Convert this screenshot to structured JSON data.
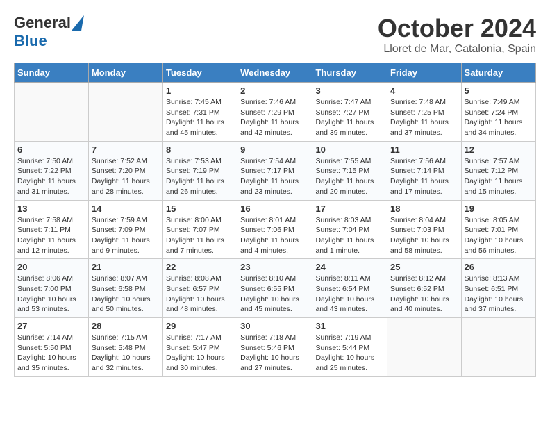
{
  "header": {
    "logo_general": "General",
    "logo_blue": "Blue",
    "month_title": "October 2024",
    "location": "Lloret de Mar, Catalonia, Spain"
  },
  "days_of_week": [
    "Sunday",
    "Monday",
    "Tuesday",
    "Wednesday",
    "Thursday",
    "Friday",
    "Saturday"
  ],
  "weeks": [
    [
      {
        "day": "",
        "info": ""
      },
      {
        "day": "",
        "info": ""
      },
      {
        "day": "1",
        "info": "Sunrise: 7:45 AM\nSunset: 7:31 PM\nDaylight: 11 hours and 45 minutes."
      },
      {
        "day": "2",
        "info": "Sunrise: 7:46 AM\nSunset: 7:29 PM\nDaylight: 11 hours and 42 minutes."
      },
      {
        "day": "3",
        "info": "Sunrise: 7:47 AM\nSunset: 7:27 PM\nDaylight: 11 hours and 39 minutes."
      },
      {
        "day": "4",
        "info": "Sunrise: 7:48 AM\nSunset: 7:25 PM\nDaylight: 11 hours and 37 minutes."
      },
      {
        "day": "5",
        "info": "Sunrise: 7:49 AM\nSunset: 7:24 PM\nDaylight: 11 hours and 34 minutes."
      }
    ],
    [
      {
        "day": "6",
        "info": "Sunrise: 7:50 AM\nSunset: 7:22 PM\nDaylight: 11 hours and 31 minutes."
      },
      {
        "day": "7",
        "info": "Sunrise: 7:52 AM\nSunset: 7:20 PM\nDaylight: 11 hours and 28 minutes."
      },
      {
        "day": "8",
        "info": "Sunrise: 7:53 AM\nSunset: 7:19 PM\nDaylight: 11 hours and 26 minutes."
      },
      {
        "day": "9",
        "info": "Sunrise: 7:54 AM\nSunset: 7:17 PM\nDaylight: 11 hours and 23 minutes."
      },
      {
        "day": "10",
        "info": "Sunrise: 7:55 AM\nSunset: 7:15 PM\nDaylight: 11 hours and 20 minutes."
      },
      {
        "day": "11",
        "info": "Sunrise: 7:56 AM\nSunset: 7:14 PM\nDaylight: 11 hours and 17 minutes."
      },
      {
        "day": "12",
        "info": "Sunrise: 7:57 AM\nSunset: 7:12 PM\nDaylight: 11 hours and 15 minutes."
      }
    ],
    [
      {
        "day": "13",
        "info": "Sunrise: 7:58 AM\nSunset: 7:11 PM\nDaylight: 11 hours and 12 minutes."
      },
      {
        "day": "14",
        "info": "Sunrise: 7:59 AM\nSunset: 7:09 PM\nDaylight: 11 hours and 9 minutes."
      },
      {
        "day": "15",
        "info": "Sunrise: 8:00 AM\nSunset: 7:07 PM\nDaylight: 11 hours and 7 minutes."
      },
      {
        "day": "16",
        "info": "Sunrise: 8:01 AM\nSunset: 7:06 PM\nDaylight: 11 hours and 4 minutes."
      },
      {
        "day": "17",
        "info": "Sunrise: 8:03 AM\nSunset: 7:04 PM\nDaylight: 11 hours and 1 minute."
      },
      {
        "day": "18",
        "info": "Sunrise: 8:04 AM\nSunset: 7:03 PM\nDaylight: 10 hours and 58 minutes."
      },
      {
        "day": "19",
        "info": "Sunrise: 8:05 AM\nSunset: 7:01 PM\nDaylight: 10 hours and 56 minutes."
      }
    ],
    [
      {
        "day": "20",
        "info": "Sunrise: 8:06 AM\nSunset: 7:00 PM\nDaylight: 10 hours and 53 minutes."
      },
      {
        "day": "21",
        "info": "Sunrise: 8:07 AM\nSunset: 6:58 PM\nDaylight: 10 hours and 50 minutes."
      },
      {
        "day": "22",
        "info": "Sunrise: 8:08 AM\nSunset: 6:57 PM\nDaylight: 10 hours and 48 minutes."
      },
      {
        "day": "23",
        "info": "Sunrise: 8:10 AM\nSunset: 6:55 PM\nDaylight: 10 hours and 45 minutes."
      },
      {
        "day": "24",
        "info": "Sunrise: 8:11 AM\nSunset: 6:54 PM\nDaylight: 10 hours and 43 minutes."
      },
      {
        "day": "25",
        "info": "Sunrise: 8:12 AM\nSunset: 6:52 PM\nDaylight: 10 hours and 40 minutes."
      },
      {
        "day": "26",
        "info": "Sunrise: 8:13 AM\nSunset: 6:51 PM\nDaylight: 10 hours and 37 minutes."
      }
    ],
    [
      {
        "day": "27",
        "info": "Sunrise: 7:14 AM\nSunset: 5:50 PM\nDaylight: 10 hours and 35 minutes."
      },
      {
        "day": "28",
        "info": "Sunrise: 7:15 AM\nSunset: 5:48 PM\nDaylight: 10 hours and 32 minutes."
      },
      {
        "day": "29",
        "info": "Sunrise: 7:17 AM\nSunset: 5:47 PM\nDaylight: 10 hours and 30 minutes."
      },
      {
        "day": "30",
        "info": "Sunrise: 7:18 AM\nSunset: 5:46 PM\nDaylight: 10 hours and 27 minutes."
      },
      {
        "day": "31",
        "info": "Sunrise: 7:19 AM\nSunset: 5:44 PM\nDaylight: 10 hours and 25 minutes."
      },
      {
        "day": "",
        "info": ""
      },
      {
        "day": "",
        "info": ""
      }
    ]
  ]
}
